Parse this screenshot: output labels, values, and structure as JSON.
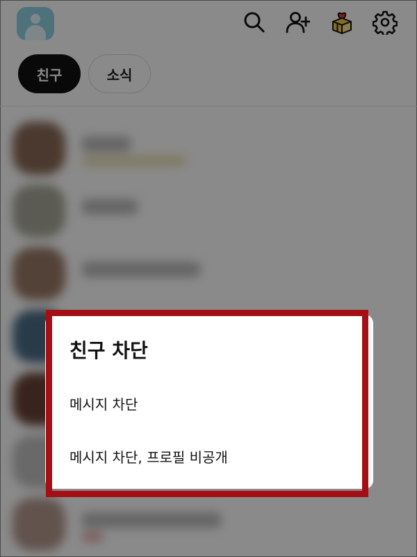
{
  "header": {
    "profile_icon": "profile-avatar-icon",
    "icons": [
      "search-icon",
      "add-friend-icon",
      "gift-icon",
      "settings-icon"
    ]
  },
  "tabs": [
    {
      "label": "친구",
      "active": true
    },
    {
      "label": "소식",
      "active": false
    }
  ],
  "dialog": {
    "title": "친구 차단",
    "options": [
      "메시지 차단",
      "메시지 차단, 프로필 비공개"
    ]
  },
  "colors": {
    "accent_highlight": "#a40f15",
    "active_tab": "#111111",
    "avatar": "#8fd3e6",
    "gift_heart": "#e53935",
    "gift_box": "#f2c94c"
  }
}
